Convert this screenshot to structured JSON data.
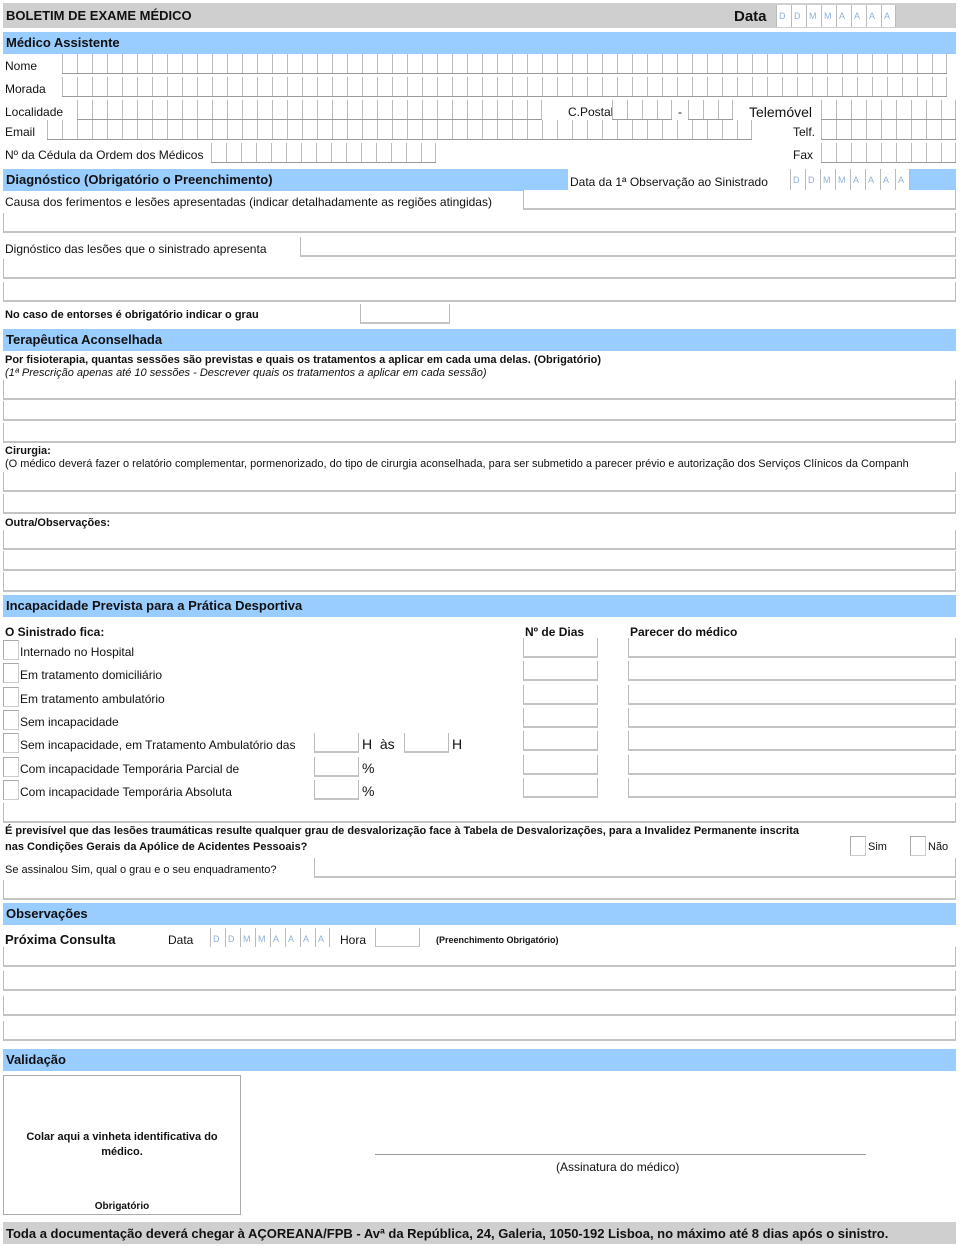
{
  "header": {
    "title": "BOLETIM DE EXAME MÉDICO",
    "date_label": "Data",
    "date_placeholder": [
      "D",
      "D",
      "M",
      "M",
      "A",
      "A",
      "A",
      "A"
    ]
  },
  "medico": {
    "section_title": "Médico Assistente",
    "nome_label": "Nome",
    "morada_label": "Morada",
    "localidade_label": "Localidade",
    "cpostal_label": "C.Postal",
    "cpostal_sep": "-",
    "telemovel_label": "Telemóvel",
    "email_label": "Email",
    "telf_label": "Telf.",
    "cedula_label": "Nº da Cédula da Ordem dos Médicos",
    "fax_label": "Fax"
  },
  "diagnostico": {
    "section_title": "Diagnóstico (Obrigatório o Preenchimento)",
    "first_obs_label": "Data da 1ª Observação ao Sinistrado",
    "first_obs_placeholder": [
      "D",
      "D",
      "M",
      "M",
      "A",
      "A",
      "A",
      "A"
    ],
    "causa_label": "Causa dos ferimentos e lesões apresentadas (indicar detalhadamente as regiões atingidas)",
    "lesoes_label": "Dignóstico das lesões que o sinistrado apresenta",
    "entorses_label": "No caso de entorses é obrigatório indicar o grau"
  },
  "terapeutica": {
    "section_title": "Terapêutica Aconselhada",
    "fisio_label": "Por fisioterapia, quantas sessões são previstas e quais os tratamentos a aplicar em cada uma delas. (Obrigatório)",
    "fisio_note": "(1ª Prescrição apenas até 10 sessões - Descrever quais os tratamentos a aplicar em cada sessão)",
    "cirurgia_label": "Cirurgia:",
    "cirurgia_note": "(O médico deverá fazer o relatório complementar, pormenorizado, do tipo de cirurgia aconselhada, para ser submetido a parecer prévio e autorização  dos Serviços Clínicos da Companh",
    "outra_label": "Outra/Observações:"
  },
  "incapacidade": {
    "section_title": "Incapacidade Prevista para a Prática Desportiva",
    "sinistrado_label": "O Sinistrado fica:",
    "dias_label": "Nº de Dias",
    "parecer_label": "Parecer do médico",
    "options": [
      {
        "label": "Internado no Hospital"
      },
      {
        "label": "Em tratamento domiciliário"
      },
      {
        "label": "Em tratamento ambulatório"
      },
      {
        "label": "Sem incapacidade"
      },
      {
        "label": "Sem incapacidade, em Tratamento Ambulatório das",
        "suffix1": "H  às",
        "suffix2": "H"
      },
      {
        "label": "Com incapacidade Temporária Parcial de",
        "suffix1": "%"
      },
      {
        "label": "Com incapacidade Temporária Absoluta",
        "suffix1": "%"
      }
    ],
    "desval_question_1": "É previsível que das lesões traumáticas resulte qualquer grau de desvalorização face à Tabela de Desvalorizações, para a Invalidez Permanente inscrita",
    "desval_question_2": "nas Condições Gerais da Apólice de Acidentes Pessoais?",
    "sim_label": "Sim",
    "nao_label": "Não",
    "grau_label": "Se assinalou Sim, qual o grau e o seu enquadramento?"
  },
  "observacoes": {
    "section_title": "Observações",
    "proxima_label": "Próxima Consulta",
    "data_label": "Data",
    "data_placeholder": [
      "D",
      "D",
      "M",
      "M",
      "A",
      "A",
      "A",
      "A"
    ],
    "hora_label": "Hora",
    "obrigatorio_note": "(Preenchimento Obrigatório)"
  },
  "validacao": {
    "section_title": "Validação",
    "vinheta_text": "Colar aqui a vinheta identificativa do médico.",
    "vinheta_note": "Obrigatório",
    "assinatura_label": "(Assinatura do médico)"
  },
  "footer": {
    "text": "Toda a documentação deverá chegar à AÇOREANA/FPB - Avª da República, 24, Galeria, 1050-192 Lisboa, no máximo até 8 dias após o sinistro."
  }
}
